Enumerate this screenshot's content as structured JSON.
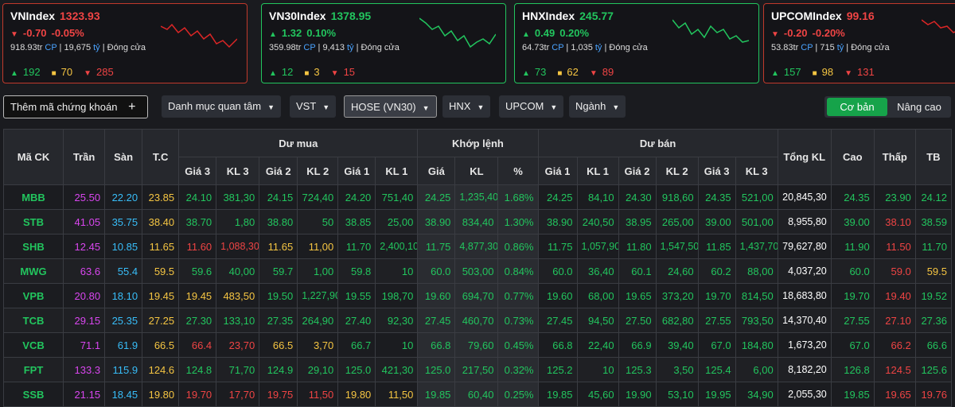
{
  "indices": [
    {
      "name": "VNIndex",
      "value": "1323.93",
      "change": "-0.70",
      "pct": "-0.05%",
      "trend": "down",
      "volume": "918.93tr",
      "cp": "CP",
      "value_traded": "19,675",
      "unit": "tỷ",
      "status": "Đóng cửa",
      "up": "192",
      "ref": "70",
      "down": "285"
    },
    {
      "name": "VN30Index",
      "value": "1378.95",
      "change": "1.32",
      "pct": "0.10%",
      "trend": "up",
      "volume": "359.98tr",
      "cp": "CP",
      "value_traded": "9,413",
      "unit": "tỷ",
      "status": "Đóng cửa",
      "up": "12",
      "ref": "3",
      "down": "15"
    },
    {
      "name": "HNXIndex",
      "value": "245.77",
      "change": "0.49",
      "pct": "0.20%",
      "trend": "up",
      "volume": "64.73tr",
      "cp": "CP",
      "value_traded": "1,035",
      "unit": "tỷ",
      "status": "Đóng cửa",
      "up": "73",
      "ref": "62",
      "down": "89"
    },
    {
      "name": "UPCOMIndex",
      "value": "99.16",
      "change": "-0.20",
      "pct": "-0.20%",
      "trend": "down",
      "volume": "53.83tr",
      "cp": "CP",
      "value_traded": "715",
      "unit": "tỷ",
      "status": "Đóng cửa",
      "up": "157",
      "ref": "98",
      "down": "131"
    }
  ],
  "toolbar": {
    "add_label": "Thêm mã chứng khoán",
    "add_icon": "+",
    "watchlist": "Danh mục quan tâm",
    "vst": "VST",
    "hose": "HOSE (VN30)",
    "hnx": "HNX",
    "upcom": "UPCOM",
    "industry": "Ngành",
    "basic": "Cơ bản",
    "advanced": "Nâng cao"
  },
  "table": {
    "h_symbol": "Mã CK",
    "h_ceiling": "Trần",
    "h_floor": "Sàn",
    "h_ref": "T.C",
    "h_bid": "Dư mua",
    "h_match": "Khớp lệnh",
    "h_ask": "Dư bán",
    "h_total": "Tổng KL",
    "h_high": "Cao",
    "h_low": "Thấp",
    "h_avg": "TB",
    "sub": [
      "Giá 3",
      "KL 3",
      "Giá 2",
      "KL 2",
      "Giá 1",
      "KL 1",
      "Giá",
      "KL",
      "%",
      "Giá 1",
      "KL 1",
      "Giá 2",
      "KL 2",
      "Giá 3",
      "KL 3"
    ],
    "rows": [
      [
        "MBB",
        "25.50",
        "22.20",
        "23.85",
        "24.10",
        "381,30",
        "24.15",
        "724,40",
        "24.20",
        "751,40",
        "24.25",
        "1,235,40",
        "1.68%",
        "24.25",
        "84,10",
        "24.30",
        "918,60",
        "24.35",
        "521,00",
        "20,845,30",
        "24.35",
        "23.90",
        "24.12"
      ],
      [
        "STB",
        "41.05",
        "35.75",
        "38.40",
        "38.70",
        "1,80",
        "38.80",
        "50",
        "38.85",
        "25,00",
        "38.90",
        "834,40",
        "1.30%",
        "38.90",
        "240,50",
        "38.95",
        "265,00",
        "39.00",
        "501,00",
        "8,955,80",
        "39.00",
        "38.10",
        "38.59"
      ],
      [
        "SHB",
        "12.45",
        "10.85",
        "11.65",
        "11.60",
        "1,088,30",
        "11.65",
        "11,00",
        "11.70",
        "2,400,10",
        "11.75",
        "4,877,30",
        "0.86%",
        "11.75",
        "1,057,90",
        "11.80",
        "1,547,50",
        "11.85",
        "1,437,70",
        "79,627,80",
        "11.90",
        "11.50",
        "11.70"
      ],
      [
        "MWG",
        "63.6",
        "55.4",
        "59.5",
        "59.6",
        "40,00",
        "59.7",
        "1,00",
        "59.8",
        "10",
        "60.0",
        "503,00",
        "0.84%",
        "60.0",
        "36,40",
        "60.1",
        "24,60",
        "60.2",
        "88,00",
        "4,037,20",
        "60.0",
        "59.0",
        "59.5"
      ],
      [
        "VPB",
        "20.80",
        "18.10",
        "19.45",
        "19.45",
        "483,50",
        "19.50",
        "1,227,90",
        "19.55",
        "198,70",
        "19.60",
        "694,70",
        "0.77%",
        "19.60",
        "68,00",
        "19.65",
        "373,20",
        "19.70",
        "814,50",
        "18,683,80",
        "19.70",
        "19.40",
        "19.52"
      ],
      [
        "TCB",
        "29.15",
        "25.35",
        "27.25",
        "27.30",
        "133,10",
        "27.35",
        "264,90",
        "27.40",
        "92,30",
        "27.45",
        "460,70",
        "0.73%",
        "27.45",
        "94,50",
        "27.50",
        "682,80",
        "27.55",
        "793,50",
        "14,370,40",
        "27.55",
        "27.10",
        "27.36"
      ],
      [
        "VCB",
        "71.1",
        "61.9",
        "66.5",
        "66.4",
        "23,70",
        "66.5",
        "3,70",
        "66.7",
        "10",
        "66.8",
        "79,60",
        "0.45%",
        "66.8",
        "22,40",
        "66.9",
        "39,40",
        "67.0",
        "184,80",
        "1,673,20",
        "67.0",
        "66.2",
        "66.6"
      ],
      [
        "FPT",
        "133.3",
        "115.9",
        "124.6",
        "124.8",
        "71,70",
        "124.9",
        "29,10",
        "125.0",
        "421,30",
        "125.0",
        "217,50",
        "0.32%",
        "125.2",
        "10",
        "125.3",
        "3,50",
        "125.4",
        "6,00",
        "8,182,20",
        "126.8",
        "124.5",
        "125.6"
      ],
      [
        "SSB",
        "21.15",
        "18.45",
        "19.80",
        "19.70",
        "17,70",
        "19.75",
        "11,50",
        "19.80",
        "11,50",
        "19.85",
        "60,40",
        "0.25%",
        "19.85",
        "45,60",
        "19.90",
        "53,10",
        "19.95",
        "34,90",
        "2,055,30",
        "19.85",
        "19.65",
        "19.76"
      ]
    ]
  }
}
